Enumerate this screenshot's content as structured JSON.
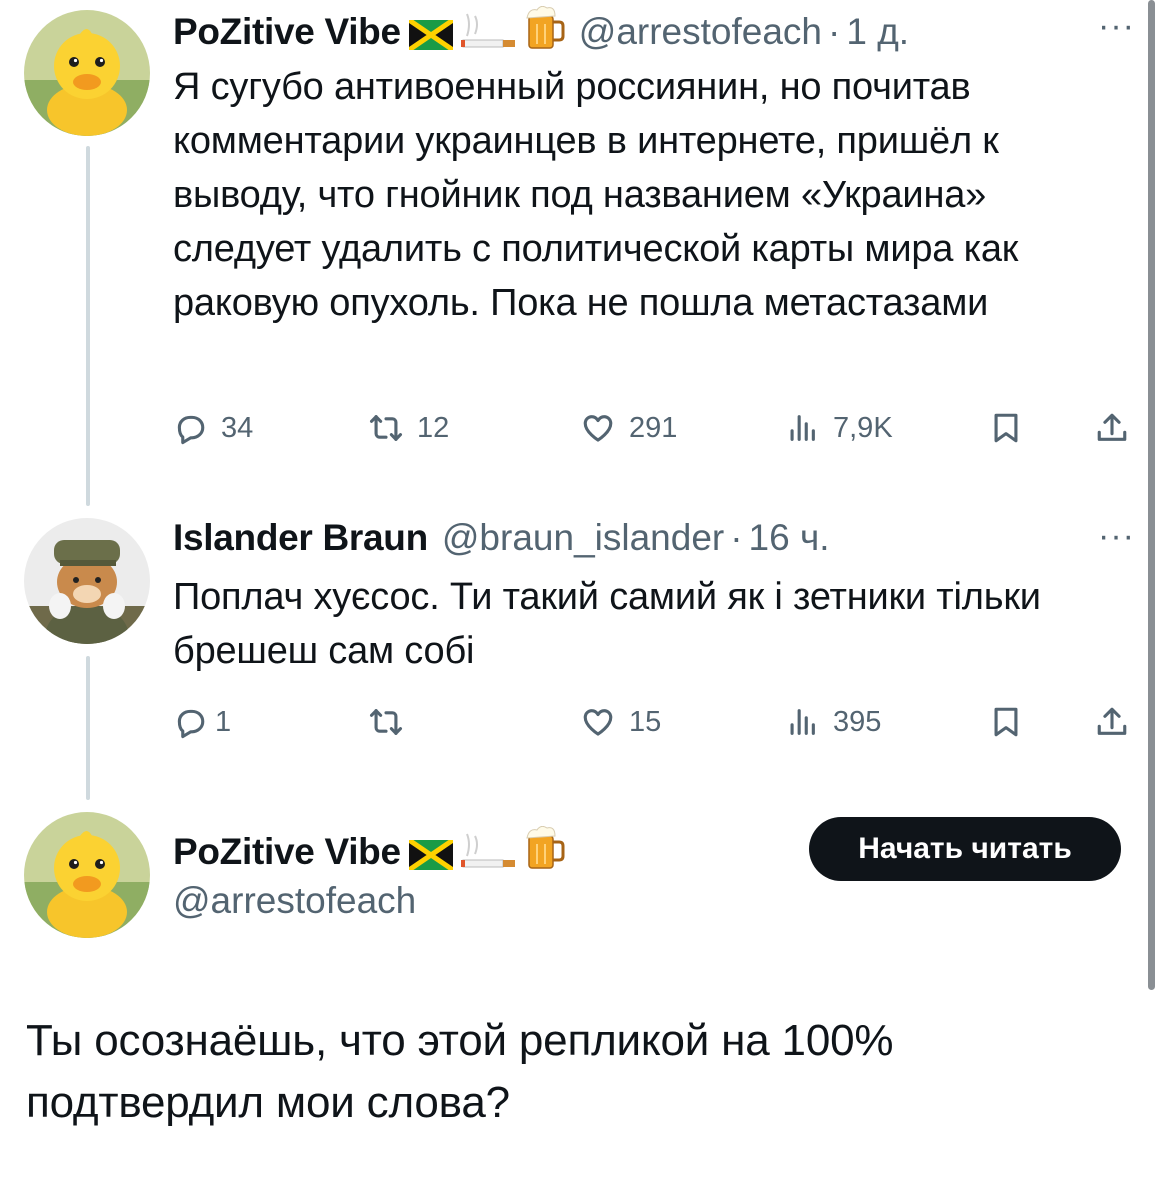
{
  "tweets": [
    {
      "author_name": "PoZitive Vibe",
      "author_emojis": [
        "jamaica-flag",
        "cigarette",
        "beer-mug"
      ],
      "handle": "@arrestofeach",
      "separator": "·",
      "time": "1 д.",
      "text": "Я сугубо антивоенный россиянин, но почитав комментарии украинцев в интернете, пришёл к выводу, что гнойник под названием «Украина» следует удалить с политической карты мира как раковую опухоль. Пока не пошла метастазами",
      "replies": "34",
      "retweets": "12",
      "likes": "291",
      "views": "7,9K"
    },
    {
      "author_name": "Islander Braun",
      "handle": "@braun_islander",
      "separator": "·",
      "time": "16 ч.",
      "text": "Поплач хуєсос. Ти такий самий як і зетники тільки брешеш сам собі",
      "replies": "1",
      "retweets": "",
      "likes": "15",
      "views": "395"
    }
  ],
  "focused": {
    "author_name": "PoZitive Vibe",
    "author_emojis": [
      "jamaica-flag",
      "cigarette",
      "beer-mug"
    ],
    "handle": "@arrestofeach",
    "follow_label": "Начать читать",
    "text": "Ты осознаёшь, что этой репликой на 100% подтвердил мои слова?"
  },
  "colors": {
    "text": "#0f1419",
    "secondary": "#536471",
    "thread_line": "#cfd9de",
    "button_bg": "#0f1419"
  }
}
